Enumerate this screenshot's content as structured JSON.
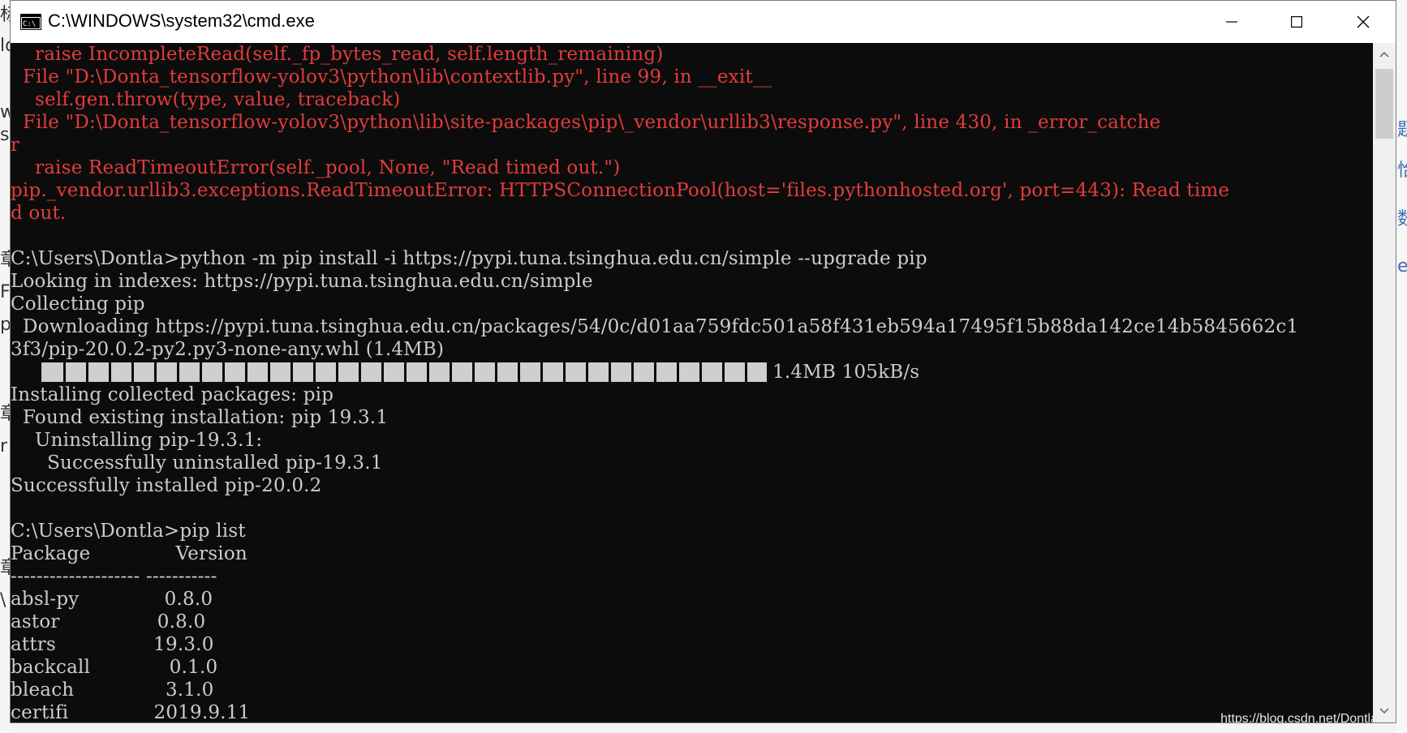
{
  "window": {
    "title": "C:\\WINDOWS\\system32\\cmd.exe",
    "icon": "cmd-app-icon",
    "controls": {
      "minimize": "minimize-icon",
      "maximize": "maximize-icon",
      "close": "close-icon"
    }
  },
  "console_lines": [
    {
      "text": "    raise IncompleteRead(self._fp_bytes_read, self.length_remaining)",
      "kind": "err"
    },
    {
      "text": "  File \"D:\\Donta_tensorflow-yolov3\\python\\lib\\contextlib.py\", line 99, in __exit__",
      "kind": "err"
    },
    {
      "text": "    self.gen.throw(type, value, traceback)",
      "kind": "err"
    },
    {
      "text": "  File \"D:\\Donta_tensorflow-yolov3\\python\\lib\\site-packages\\pip\\_vendor\\urllib3\\response.py\", line 430, in _error_catche",
      "kind": "err"
    },
    {
      "text": "r",
      "kind": "err"
    },
    {
      "text": "    raise ReadTimeoutError(self._pool, None, \"Read timed out.\")",
      "kind": "err"
    },
    {
      "text": "pip._vendor.urllib3.exceptions.ReadTimeoutError: HTTPSConnectionPool(host='files.pythonhosted.org', port=443): Read time",
      "kind": "err"
    },
    {
      "text": "d out.",
      "kind": "err"
    },
    {
      "text": "",
      "kind": "ok"
    },
    {
      "text": "C:\\Users\\Dontla>python -m pip install -i https://pypi.tuna.tsinghua.edu.cn/simple --upgrade pip",
      "kind": "ok"
    },
    {
      "text": "Looking in indexes: https://pypi.tuna.tsinghua.edu.cn/simple",
      "kind": "ok"
    },
    {
      "text": "Collecting pip",
      "kind": "ok"
    },
    {
      "text": "  Downloading https://pypi.tuna.tsinghua.edu.cn/packages/54/0c/d01aa759fdc501a58f431eb594a17495f15b88da142ce14b5845662c1",
      "kind": "ok"
    },
    {
      "text": "3f3/pip-20.0.2-py2.py3-none-any.whl (1.4MB)",
      "kind": "ok"
    },
    {
      "kind": "progress",
      "prefix": "     ",
      "progress": 1.0,
      "suffix": " 1.4MB 105kB/s"
    },
    {
      "text": "Installing collected packages: pip",
      "kind": "ok"
    },
    {
      "text": "  Found existing installation: pip 19.3.1",
      "kind": "ok"
    },
    {
      "text": "    Uninstalling pip-19.3.1:",
      "kind": "ok"
    },
    {
      "text": "      Successfully uninstalled pip-19.3.1",
      "kind": "ok"
    },
    {
      "text": "Successfully installed pip-20.0.2",
      "kind": "ok"
    },
    {
      "text": "",
      "kind": "ok"
    },
    {
      "text": "C:\\Users\\Dontla>pip list",
      "kind": "ok"
    },
    {
      "text": "Package              Version",
      "kind": "ok"
    },
    {
      "text": "-------------------- -----------",
      "kind": "ok"
    },
    {
      "text": "absl-py              0.8.0",
      "kind": "ok"
    },
    {
      "text": "astor                0.8.0",
      "kind": "ok"
    },
    {
      "text": "attrs                19.3.0",
      "kind": "ok"
    },
    {
      "text": "backcall             0.1.0",
      "kind": "ok"
    },
    {
      "text": "bleach               3.1.0",
      "kind": "ok"
    },
    {
      "text": "certifi              2019.9.11",
      "kind": "ok"
    }
  ],
  "colors": {
    "console_bg": "#0c0c0c",
    "console_text": "#cccccc",
    "error_text": "#e23c3c"
  },
  "background": {
    "left_glyphs": [
      "标",
      "ld",
      "w",
      "s",
      "章",
      "F",
      "p",
      "章",
      "r",
      "章",
      "\\"
    ],
    "right_glyphs": [
      "题",
      "恰",
      "数",
      "e"
    ]
  },
  "watermark": "https://blog.csdn.net/Dontla"
}
